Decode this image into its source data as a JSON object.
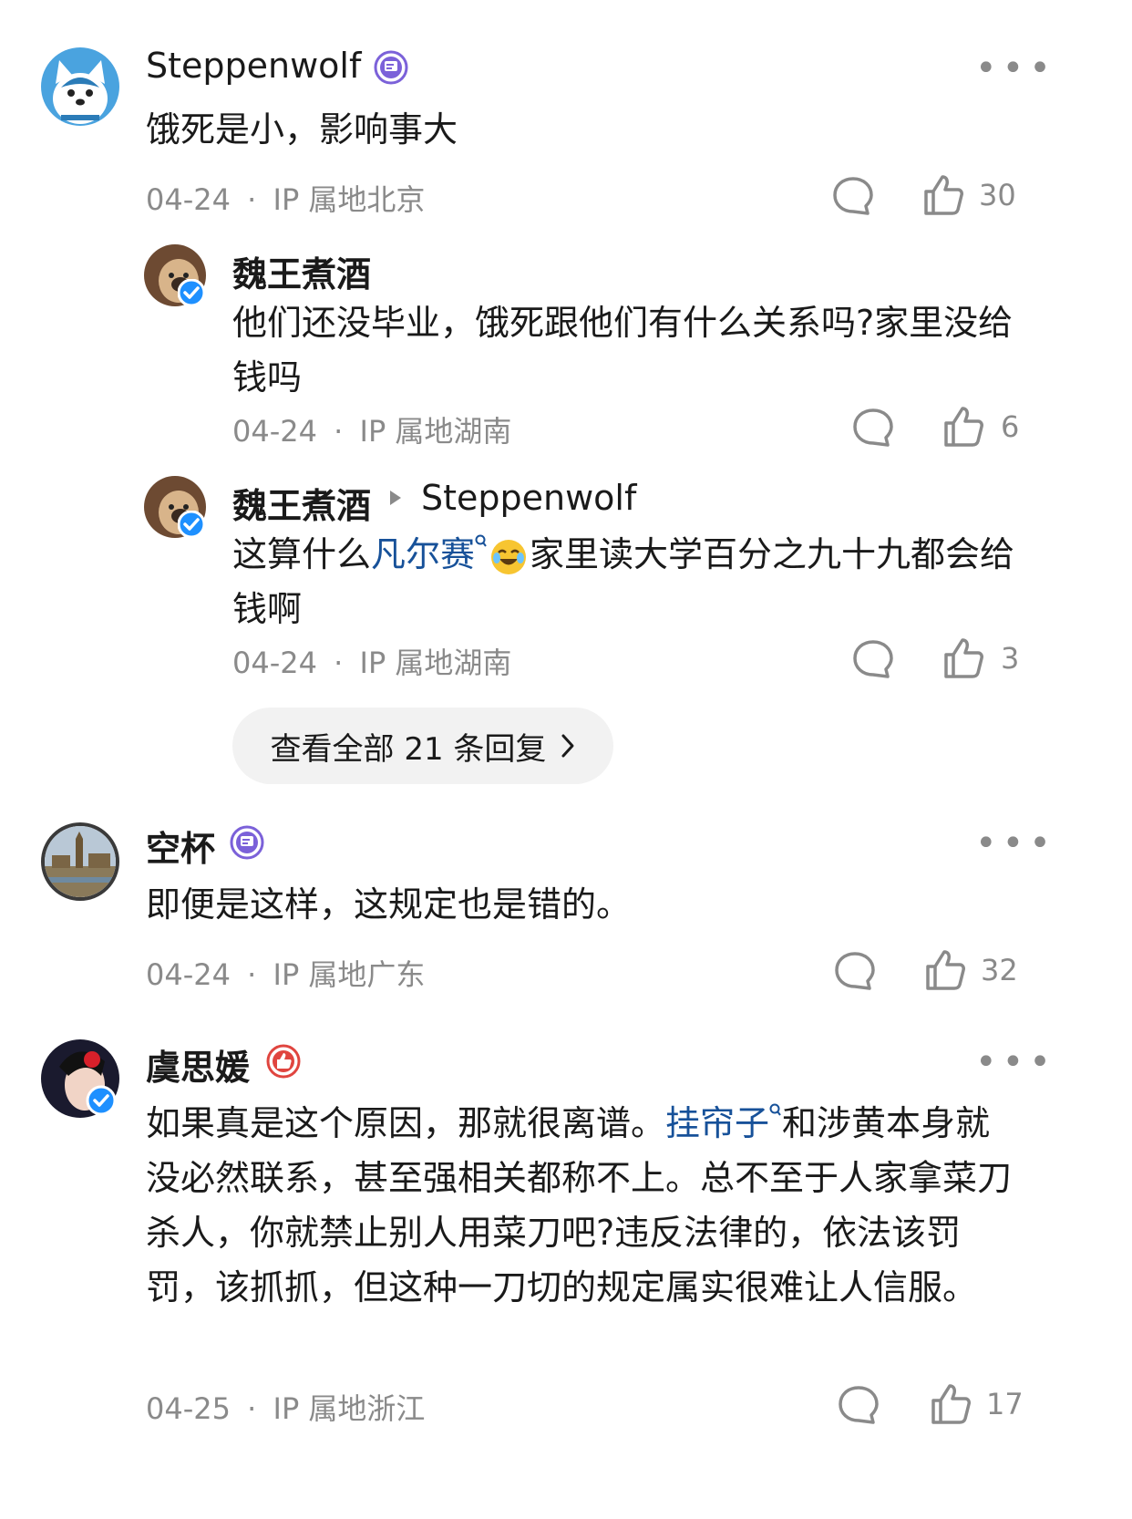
{
  "comments": [
    {
      "author": "Steppenwolf",
      "text": "饿死是小，影响事大",
      "date": "04-24",
      "ip": "IP 属地北京",
      "likes": "30",
      "replies": [
        {
          "author": "魏王煮酒",
          "text": "他们还没毕业，饿死跟他们有什么关系吗?家里没给钱吗",
          "date": "04-24",
          "ip": "IP 属地湖南",
          "likes": "6"
        },
        {
          "author": "魏王煮酒",
          "reply_to": "Steppenwolf",
          "text_before": "这算什么",
          "link": "凡尔赛",
          "text_after": "家里读大学百分之九十九都会给钱啊",
          "date": "04-24",
          "ip": "IP 属地湖南",
          "likes": "3"
        }
      ],
      "view_all": "查看全部 21 条回复"
    },
    {
      "author": "空杯",
      "text": "即便是这样，这规定也是错的。",
      "date": "04-24",
      "ip": "IP 属地广东",
      "likes": "32"
    },
    {
      "author": "虞思媛",
      "text_before": "如果真是这个原因，那就很离谱。",
      "link": "挂帘子",
      "text_after": "和涉黄本身就没必然联系，甚至强相关都称不上。总不至于人家拿菜刀杀人，你就禁止别人用菜刀吧?违反法律的，依法该罚罚，该抓抓，但这种一刀切的规定属实很难让人信服。",
      "date": "04-25",
      "ip": "IP 属地浙江",
      "likes": "17"
    }
  ],
  "separator": "·",
  "more_dots": "•••"
}
